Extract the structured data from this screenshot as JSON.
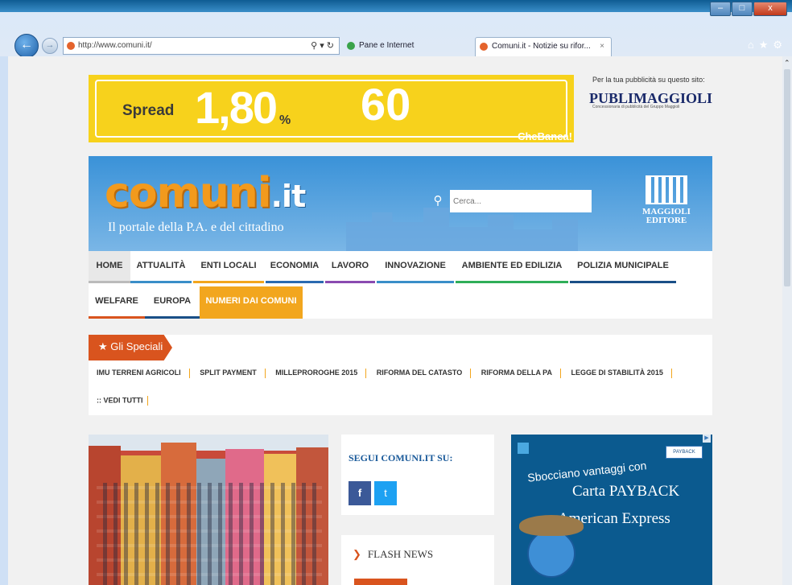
{
  "browser": {
    "address": "http://www.comuni.it/",
    "tabs": [
      {
        "label": "Pane e Internet"
      },
      {
        "label": "Comuni.it - Notizie su rifor..."
      }
    ],
    "window_buttons": {
      "minimize": "–",
      "maximize": "□",
      "close": "x"
    },
    "toolbar_icons": [
      "home-icon",
      "star-icon",
      "gear-icon"
    ]
  },
  "banner_ad": {
    "spread_label": "Spread",
    "value1": "1,80",
    "percent": "%",
    "value2": "60",
    "brand": "CheBanca!"
  },
  "ad_note": "Per la tua pubblicità su questo sito:",
  "publimaggioli": {
    "logo_text": "PUBLIMAGGIOLI",
    "sub": "Concessionaria di pubblicità del Gruppo Maggioli"
  },
  "header": {
    "logo_main": "comuni",
    "logo_tld": ".it",
    "tagline": "Il portale della P.A. e del cittadino",
    "search_placeholder": "Cerca...",
    "maggioli_text": "MAGGIOLI EDITORE"
  },
  "nav": {
    "row1": [
      "HOME",
      "ATTUALITÀ",
      "ENTI LOCALI",
      "ECONOMIA",
      "LAVORO",
      "INNOVAZIONE",
      "AMBIENTE ED EDILIZIA",
      "POLIZIA MUNICIPALE"
    ],
    "row2": [
      "WELFARE",
      "EUROPA",
      "NUMERI DAI COMUNI"
    ]
  },
  "speciali": {
    "title": "Gli Speciali",
    "links": [
      "IMU TERRENI AGRICOLI",
      "SPLIT PAYMENT",
      "MILLEPROROGHE 2015",
      "RIFORMA DEL CATASTO",
      "RIFORMA DELLA PA",
      "LEGGE DI STABILITÀ 2015"
    ],
    "more": ":: VEDI TUTTI"
  },
  "social": {
    "heading": "SEGUI COMUNI.IT SU:",
    "facebook": "f",
    "twitter": "t"
  },
  "flash_news": {
    "heading": "FLASH NEWS"
  },
  "amex_ad": {
    "line1": "Sbocciano vantaggi con",
    "line2": "Carta PAYBACK",
    "line3": "American Express",
    "payback_label": "PAYBACK"
  }
}
